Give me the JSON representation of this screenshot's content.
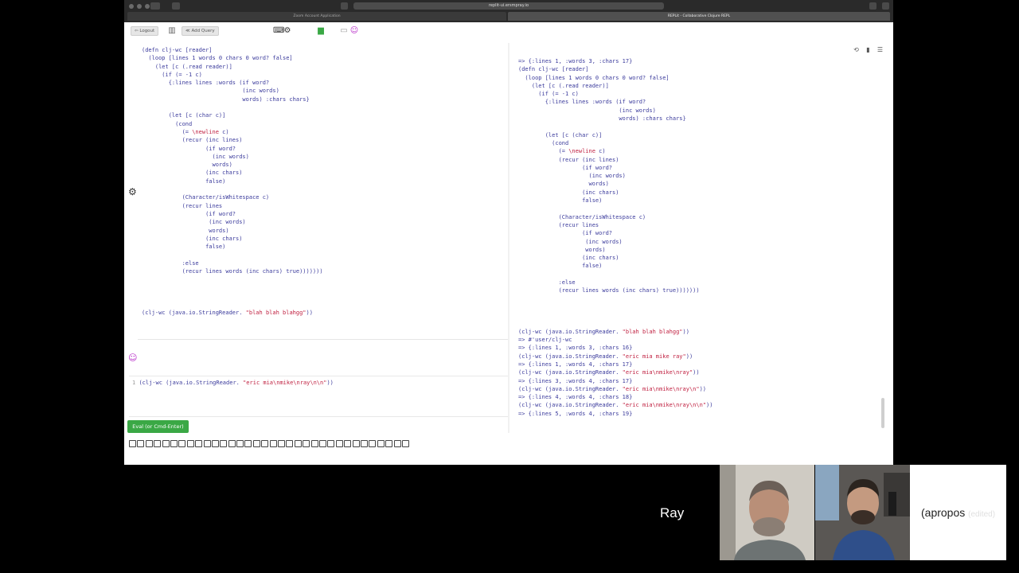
{
  "browser": {
    "url": "replit-ui.ersmpray.io",
    "tabs": [
      "Zoom Account Application",
      "REPLit - Collaborative Clojure REPL"
    ]
  },
  "toolbar": {
    "logout_label": "Logout",
    "add_query_label": "Add Query"
  },
  "editor_lines": [
    "(defn clj-wc [reader]",
    "  (loop [lines 1 words 0 chars 0 word? false]",
    "    (let [c (.read reader)]",
    "      (if (= -1 c)",
    "        {:lines lines :words (if word?",
    "                              (inc words)",
    "                              words) :chars chars}",
    "",
    "        (let [c (char c)]",
    "          (cond",
    "            (= \\newline c)",
    "            (recur (inc lines)",
    "                   (if word?",
    "                     (inc words)",
    "                     words)",
    "                   (inc chars)",
    "                   false)",
    "",
    "            (Character/isWhitespace c)",
    "            (recur lines",
    "                   (if word?",
    "                    (inc words)",
    "                    words)",
    "                   (inc chars)",
    "                   false)",
    "",
    "            :else",
    "            (recur lines words (inc chars) true)))))))",
    "",
    "",
    "",
    "",
    "(clj-wc (java.io.StringReader. \"blah blah blahgg\"))"
  ],
  "input": {
    "line_number": "1",
    "text": "(clj-wc (java.io.StringReader. \"eric mia\\nmike\\nray\\n\\n\"))"
  },
  "eval_button_label": "Eval (or Cmd-Enter)",
  "output_lines": [
    "=> {:lines 1, :words 3, :chars 17}",
    "(defn clj-wc [reader]",
    "  (loop [lines 1 words 0 chars 0 word? false]",
    "    (let [c (.read reader)]",
    "      (if (= -1 c)",
    "        {:lines lines :words (if word?",
    "                              (inc words)",
    "                              words) :chars chars}",
    "",
    "        (let [c (char c)]",
    "          (cond",
    "            (= \\newline c)",
    "            (recur (inc lines)",
    "                   (if word?",
    "                     (inc words)",
    "                     words)",
    "                   (inc chars)",
    "                   false)",
    "",
    "            (Character/isWhitespace c)",
    "            (recur lines",
    "                   (if word?",
    "                    (inc words)",
    "                    words)",
    "                   (inc chars)",
    "                   false)",
    "",
    "            :else",
    "            (recur lines words (inc chars) true)))))))",
    "",
    "",
    "",
    "",
    "(clj-wc (java.io.StringReader. \"blah blah blahgg\"))",
    "=> #'user/clj-wc",
    "=> {:lines 1, :words 3, :chars 16}",
    "(clj-wc (java.io.StringReader. \"eric mia mike ray\"))",
    "=> {:lines 1, :words 4, :chars 17}",
    "(clj-wc (java.io.StringReader. \"eric mia\\nmike\\nray\"))",
    "=> {:lines 3, :words 4, :chars 17}",
    "(clj-wc (java.io.StringReader. \"eric mia\\nmike\\nray\\n\"))",
    "=> {:lines 4, :words 4, :chars 18}",
    "(clj-wc (java.io.StringReader. \"eric mia\\nmike\\nray\\n\\n\"))",
    "=> {:lines 5, :words 4, :chars 19}"
  ],
  "call": {
    "speaker_name": "Ray",
    "tile3_text": "(apropos",
    "tile3_subtext": "(edited)"
  },
  "colors": {
    "eval_button": "#3aa845",
    "code_text": "#3b3b9c",
    "string_literal": "#c02040",
    "accent_purple": "#b72cc8"
  }
}
